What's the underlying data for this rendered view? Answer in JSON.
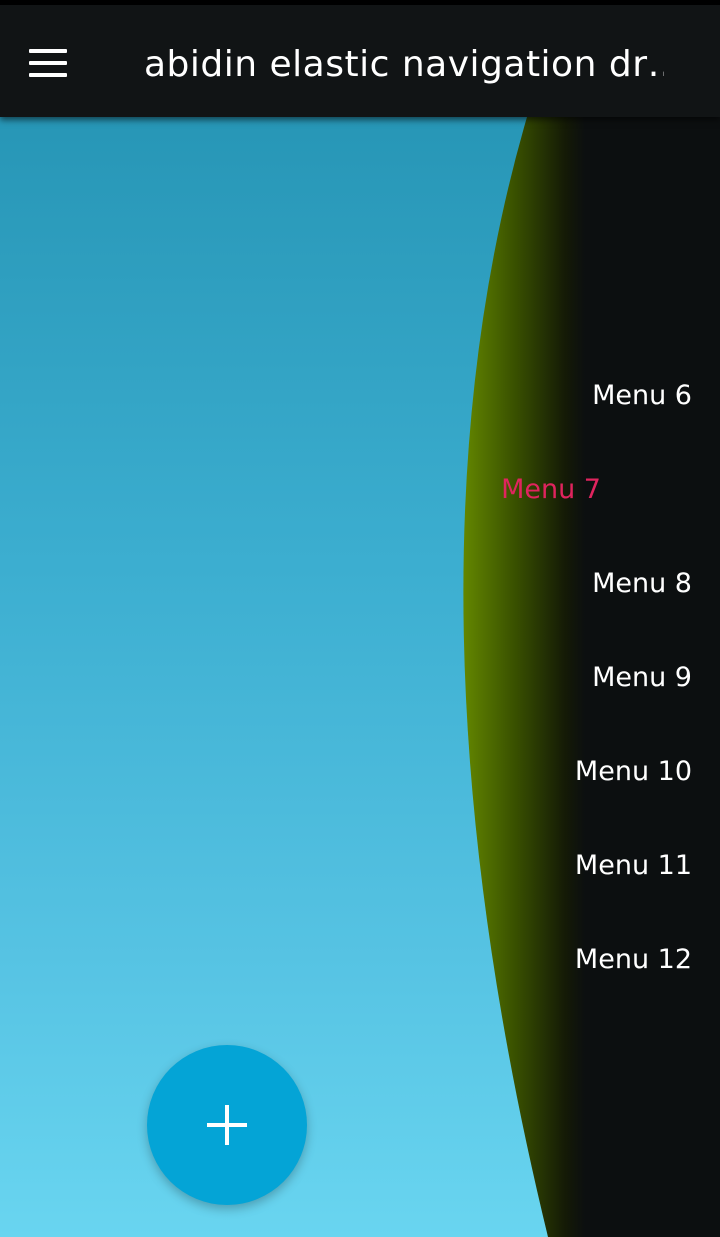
{
  "toolbar": {
    "title": "abidin elastic navigation dr…",
    "menu_icon": "hamburger-icon"
  },
  "drawer": {
    "items": [
      {
        "label": "Menu 6",
        "active": false
      },
      {
        "label": "Menu 7",
        "active": true
      },
      {
        "label": "Menu 8",
        "active": false
      },
      {
        "label": "Menu 9",
        "active": false
      },
      {
        "label": "Menu 10",
        "active": false
      },
      {
        "label": "Menu 11",
        "active": false
      },
      {
        "label": "Menu 12",
        "active": false
      }
    ],
    "active_color": "#e0245e",
    "background_color": "#0c0f10",
    "edge_color": "#6a8f00"
  },
  "fab": {
    "icon": "plus-icon",
    "color": "#04a4d6"
  },
  "colors": {
    "toolbar_bg": "#111415",
    "content_gradient_top": "#2796b6",
    "content_gradient_bottom": "#69d5f0"
  }
}
